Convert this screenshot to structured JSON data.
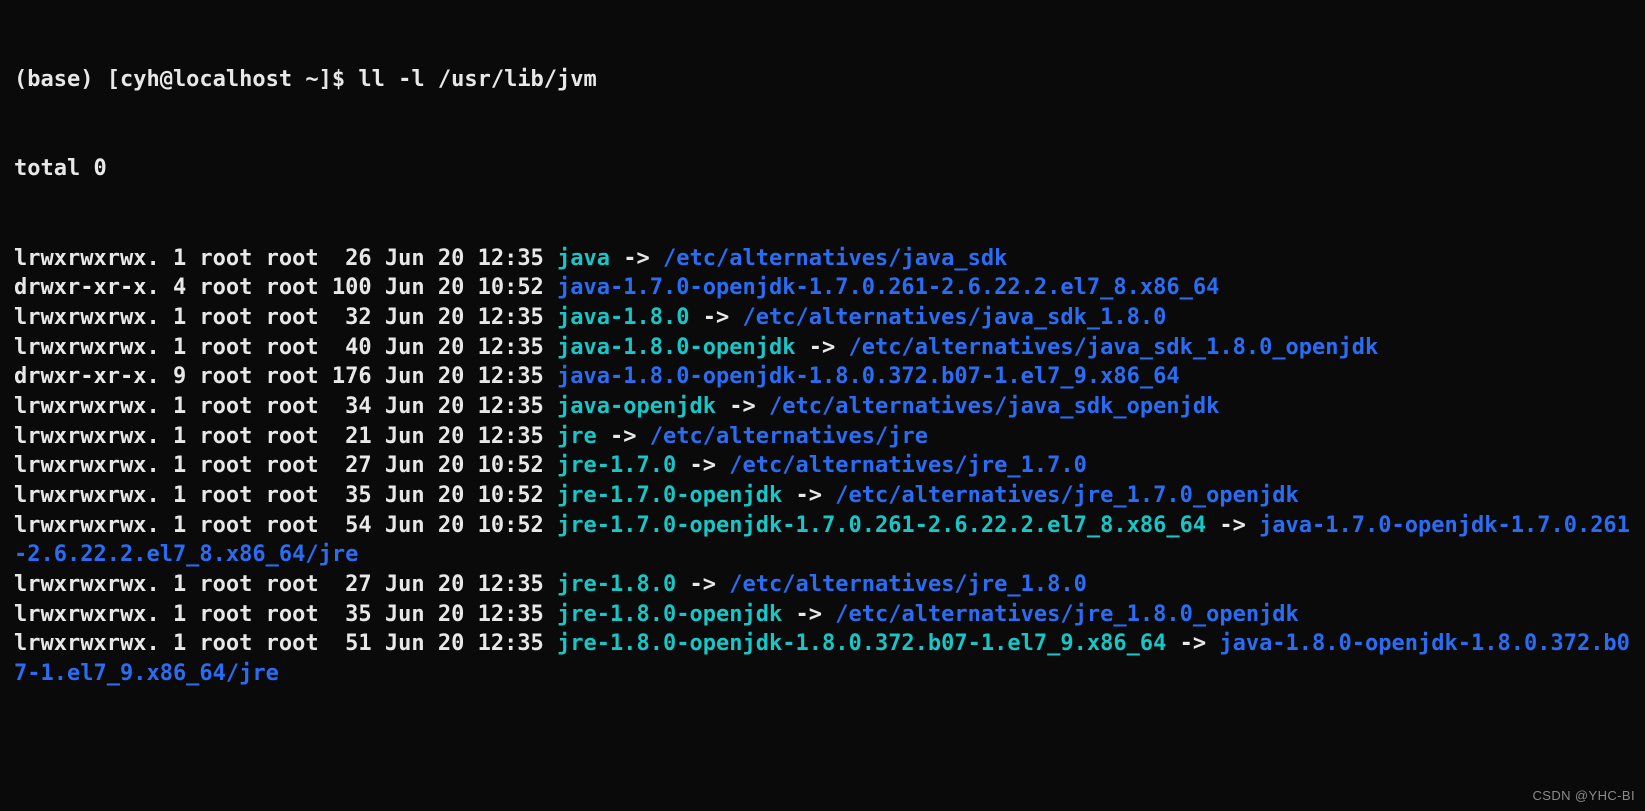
{
  "prompt_prefix": "(base) [cyh@localhost ~]$ ",
  "command": "ll -l /usr/lib/jvm",
  "total_line": "total 0",
  "arrow": " -> ",
  "entries": [
    {
      "perms": "lrwxrwxrwx.",
      "links": "1",
      "owner": "root",
      "group": "root",
      "size": " 26",
      "date": "Jun 20 12:35",
      "name": "java",
      "name_class": "link-name",
      "target": "/etc/alternatives/java_sdk",
      "target_class": "dir-name"
    },
    {
      "perms": "drwxr-xr-x.",
      "links": "4",
      "owner": "root",
      "group": "root",
      "size": "100",
      "date": "Jun 20 10:52",
      "name": "java-1.7.0-openjdk-1.7.0.261-2.6.22.2.el7_8.x86_64",
      "name_class": "dir-name",
      "target": null,
      "target_class": ""
    },
    {
      "perms": "lrwxrwxrwx.",
      "links": "1",
      "owner": "root",
      "group": "root",
      "size": " 32",
      "date": "Jun 20 12:35",
      "name": "java-1.8.0",
      "name_class": "link-name",
      "target": "/etc/alternatives/java_sdk_1.8.0",
      "target_class": "dir-name"
    },
    {
      "perms": "lrwxrwxrwx.",
      "links": "1",
      "owner": "root",
      "group": "root",
      "size": " 40",
      "date": "Jun 20 12:35",
      "name": "java-1.8.0-openjdk",
      "name_class": "link-name",
      "target": "/etc/alternatives/java_sdk_1.8.0_openjdk",
      "target_class": "dir-name"
    },
    {
      "perms": "drwxr-xr-x.",
      "links": "9",
      "owner": "root",
      "group": "root",
      "size": "176",
      "date": "Jun 20 12:35",
      "name": "java-1.8.0-openjdk-1.8.0.372.b07-1.el7_9.x86_64",
      "name_class": "dir-name",
      "target": null,
      "target_class": ""
    },
    {
      "perms": "lrwxrwxrwx.",
      "links": "1",
      "owner": "root",
      "group": "root",
      "size": " 34",
      "date": "Jun 20 12:35",
      "name": "java-openjdk",
      "name_class": "link-name",
      "target": "/etc/alternatives/java_sdk_openjdk",
      "target_class": "dir-name"
    },
    {
      "perms": "lrwxrwxrwx.",
      "links": "1",
      "owner": "root",
      "group": "root",
      "size": " 21",
      "date": "Jun 20 12:35",
      "name": "jre",
      "name_class": "link-name",
      "target": "/etc/alternatives/jre",
      "target_class": "dir-name"
    },
    {
      "perms": "lrwxrwxrwx.",
      "links": "1",
      "owner": "root",
      "group": "root",
      "size": " 27",
      "date": "Jun 20 10:52",
      "name": "jre-1.7.0",
      "name_class": "link-name",
      "target": "/etc/alternatives/jre_1.7.0",
      "target_class": "dir-name"
    },
    {
      "perms": "lrwxrwxrwx.",
      "links": "1",
      "owner": "root",
      "group": "root",
      "size": " 35",
      "date": "Jun 20 10:52",
      "name": "jre-1.7.0-openjdk",
      "name_class": "link-name",
      "target": "/etc/alternatives/jre_1.7.0_openjdk",
      "target_class": "dir-name"
    },
    {
      "perms": "lrwxrwxrwx.",
      "links": "1",
      "owner": "root",
      "group": "root",
      "size": " 54",
      "date": "Jun 20 10:52",
      "name": "jre-1.7.0-openjdk-1.7.0.261-2.6.22.2.el7_8.x86_64",
      "name_class": "link-name",
      "target": "java-1.7.0-openjdk-1.7.0.261-2.6.22.2.el7_8.x86_64/jre",
      "target_class": "dir-name"
    },
    {
      "perms": "lrwxrwxrwx.",
      "links": "1",
      "owner": "root",
      "group": "root",
      "size": " 27",
      "date": "Jun 20 12:35",
      "name": "jre-1.8.0",
      "name_class": "link-name",
      "target": "/etc/alternatives/jre_1.8.0",
      "target_class": "dir-name"
    },
    {
      "perms": "lrwxrwxrwx.",
      "links": "1",
      "owner": "root",
      "group": "root",
      "size": " 35",
      "date": "Jun 20 12:35",
      "name": "jre-1.8.0-openjdk",
      "name_class": "link-name",
      "target": "/etc/alternatives/jre_1.8.0_openjdk",
      "target_class": "dir-name"
    },
    {
      "perms": "lrwxrwxrwx.",
      "links": "1",
      "owner": "root",
      "group": "root",
      "size": " 51",
      "date": "Jun 20 12:35",
      "name": "jre-1.8.0-openjdk-1.8.0.372.b07-1.el7_9.x86_64",
      "name_class": "link-name",
      "target": "java-1.8.0-openjdk-1.8.0.372.b07-1.el7_9.x86_64/jre",
      "target_class": "dir-name"
    }
  ],
  "watermark": "CSDN @YHC-BI"
}
